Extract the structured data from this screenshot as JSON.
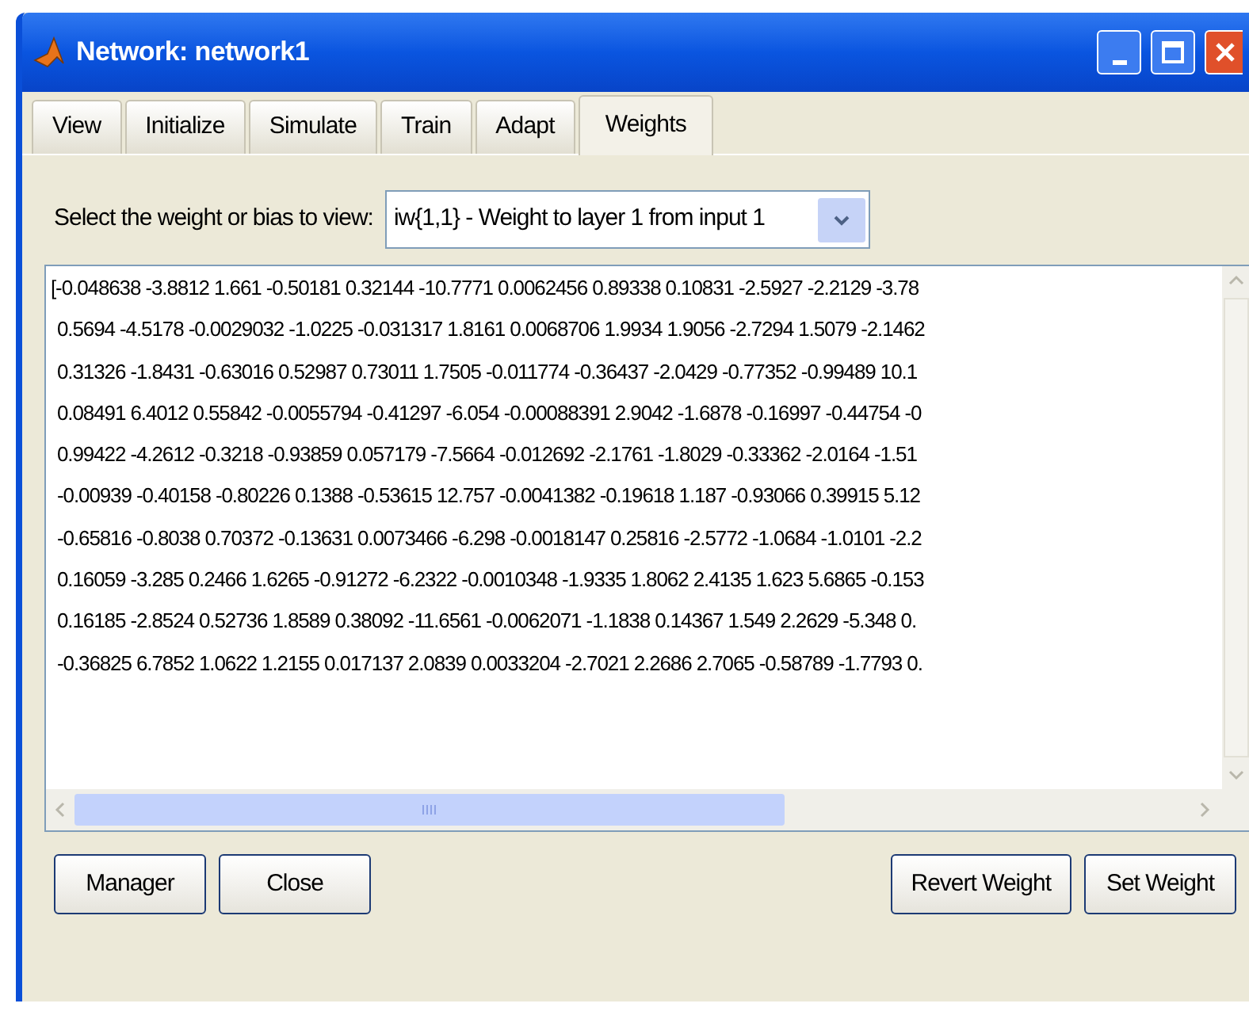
{
  "window": {
    "title": "Network: network1"
  },
  "tabs": [
    {
      "label": "View",
      "selected": false
    },
    {
      "label": "Initialize",
      "selected": false
    },
    {
      "label": "Simulate",
      "selected": false
    },
    {
      "label": "Train",
      "selected": false
    },
    {
      "label": "Adapt",
      "selected": false
    },
    {
      "label": "Weights",
      "selected": true
    }
  ],
  "selector": {
    "label": "Select the weight or bias to view:",
    "value": "iw{1,1} - Weight to layer 1 from input 1"
  },
  "matrix_rows": [
    "[-0.048638 -3.8812 1.661 -0.50181 0.32144 -10.7771 0.0062456 0.89338 0.10831 -2.5927 -2.2129 -3.78",
    "0.5694 -4.5178 -0.0029032 -1.0225 -0.031317 1.8161 0.0068706 1.9934 1.9056 -2.7294 1.5079 -2.1462",
    "0.31326 -1.8431 -0.63016 0.52987 0.73011 1.7505 -0.011774 -0.36437 -2.0429 -0.77352 -0.99489 10.1",
    "0.08491 6.4012 0.55842 -0.0055794 -0.41297 -6.054 -0.00088391 2.9042 -1.6878 -0.16997 -0.44754 -0",
    "0.99422 -4.2612 -0.3218 -0.93859 0.057179 -7.5664 -0.012692 -2.1761 -1.8029 -0.33362 -2.0164 -1.51",
    "-0.00939 -0.40158 -0.80226 0.1388 -0.53615 12.757 -0.0041382 -0.19618 1.187 -0.93066 0.39915 5.12",
    "-0.65816 -0.8038 0.70372 -0.13631 0.0073466 -6.298 -0.0018147 0.25816 -2.5772 -1.0684 -1.0101 -2.2",
    "0.16059 -3.285 0.2466 1.6265 -0.91272 -6.2322 -0.0010348 -1.9335 1.8062 2.4135 1.623 5.6865 -0.153",
    "0.16185 -2.8524 0.52736 1.8589 0.38092 -11.6561 -0.0062071 -1.1838 0.14367 1.549 2.2629 -5.348 0.",
    "-0.36825 6.7852 1.0622 1.2155 0.017137 2.0839 0.0033204 -2.7021 2.2686 2.7065 -0.58789 -1.7793 0."
  ],
  "left_buttons": [
    "Manager",
    "Close"
  ],
  "right_buttons": [
    "Revert Weight",
    "Set Weight"
  ]
}
